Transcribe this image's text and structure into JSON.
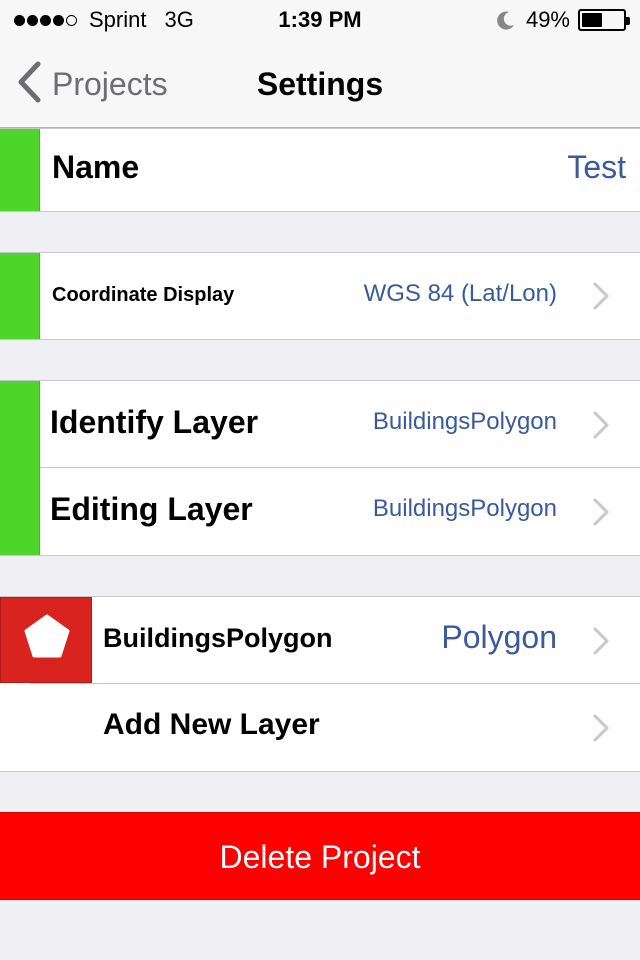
{
  "status_bar": {
    "carrier": "Sprint",
    "network": "3G",
    "time": "1:39 PM",
    "battery_percent": "49%",
    "battery_level": 0.49,
    "signal_bars_filled": 4,
    "signal_bars_total": 5
  },
  "nav": {
    "back_label": "Projects",
    "title": "Settings"
  },
  "settings": {
    "name_label": "Name",
    "name_value": "Test",
    "coord_label": "Coordinate Display",
    "coord_value": "WGS 84 (Lat/Lon)",
    "identify_label": "Identify Layer",
    "identify_value": "BuildingsPolygon",
    "editing_label": "Editing Layer",
    "editing_value": "BuildingsPolygon"
  },
  "layers": {
    "items": [
      {
        "name": "BuildingsPolygon",
        "type": "Polygon",
        "icon": "pentagon-icon",
        "color": "#d9231f"
      }
    ],
    "add_label": "Add New Layer"
  },
  "delete_label": "Delete Project",
  "colors": {
    "accent_green": "#4cd62a",
    "value_blue": "#3a5a9c",
    "delete_red": "#fe0000"
  }
}
